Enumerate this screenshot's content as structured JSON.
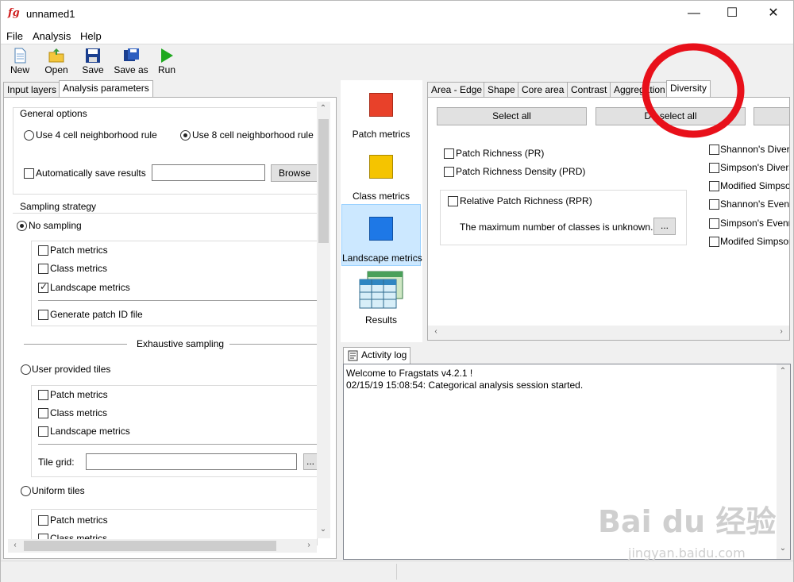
{
  "window": {
    "title": "unnamed1",
    "app_icon": "fg",
    "minimize": "—",
    "maximize": "☐",
    "close": "✕"
  },
  "menu": [
    "File",
    "Analysis",
    "Help"
  ],
  "toolbar": {
    "new": "New",
    "open": "Open",
    "save": "Save",
    "save_as": "Save as",
    "run": "Run"
  },
  "left_tabs": [
    "Input layers",
    "Analysis parameters"
  ],
  "general": {
    "title": "General options",
    "rule4": "Use 4 cell neighborhood rule",
    "rule8": "Use 8 cell neighborhood rule",
    "auto_save": "Automatically save results",
    "browse": "Browse"
  },
  "sampling": {
    "title": "Sampling strategy",
    "no_sampling": "No sampling",
    "patch": "Patch metrics",
    "class": "Class metrics",
    "landscape": "Landscape metrics",
    "gen_id": "Generate patch ID file",
    "exhaustive": "Exhaustive sampling",
    "user_tiles": "User provided tiles",
    "tile_grid": "Tile grid:",
    "ellipsis": "...",
    "uniform": "Uniform tiles",
    "patch2": "Patch metrics",
    "class2": "Class metrics"
  },
  "metric_nav": {
    "patch": "Patch metrics",
    "class": "Class metrics",
    "landscape": "Landscape metrics",
    "results": "Results"
  },
  "colors": {
    "patch": "#e8412a",
    "class": "#f5c400",
    "landscape": "#1e78e6",
    "accent": "#cce8ff",
    "annotation": "#e8101a"
  },
  "right_tabs": [
    "Area - Edge",
    "Shape",
    "Core area",
    "Contrast",
    "Aggregation",
    "Diversity"
  ],
  "diversity": {
    "select_all": "Select all",
    "deselect_all": "De-select all",
    "pr": "Patch Richness  (PR)",
    "prd": "Patch Richness Density  (PRD)",
    "rpr": "Relative Patch Richness  (RPR)",
    "max_classes": "The maximum number of classes is unknown.",
    "ellipsis": "...",
    "right_list": [
      "Shannon's Divers",
      "Simpson's Diversi",
      "Modified Simpson",
      "Shannon's Evenn",
      "Simpson's Evenn",
      "Modifed Simpson"
    ]
  },
  "activity": {
    "tab": "Activity log",
    "lines": [
      "Welcome to Fragstats v4.2.1 !",
      "02/15/19 15:08:54: Categorical analysis session started."
    ]
  },
  "watermark": {
    "brand": "Bai du 经验",
    "url": "jingyan.baidu.com"
  }
}
